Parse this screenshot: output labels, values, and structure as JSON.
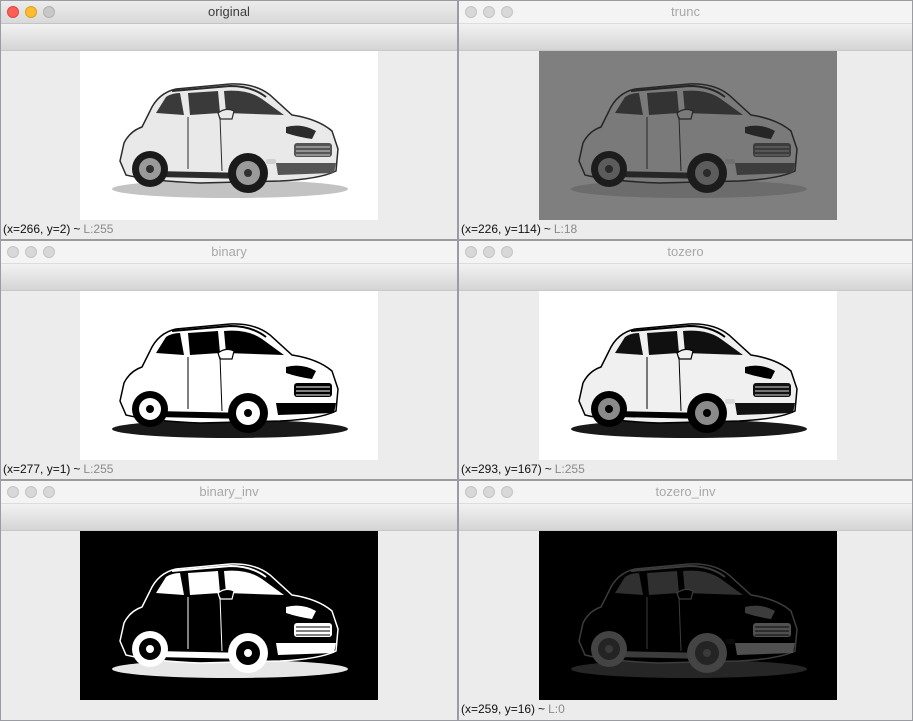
{
  "windows": [
    {
      "title": "original",
      "state": "active",
      "variant": "original",
      "coords": "(x=266, y=2)",
      "sep": "~",
      "lum": "L:255"
    },
    {
      "title": "trunc",
      "state": "inactive",
      "variant": "trunc",
      "coords": "(x=226, y=114)",
      "sep": "~",
      "lum": "L:18"
    },
    {
      "title": "binary",
      "state": "inactive",
      "variant": "binary",
      "coords": "(x=277, y=1)",
      "sep": "~",
      "lum": "L:255"
    },
    {
      "title": "tozero",
      "state": "inactive",
      "variant": "tozero",
      "coords": "(x=293, y=167)",
      "sep": "~",
      "lum": "L:255"
    },
    {
      "title": "binary_inv",
      "state": "inactive",
      "variant": "binary_inv",
      "coords": "",
      "sep": "",
      "lum": ""
    },
    {
      "title": "tozero_inv",
      "state": "inactive",
      "variant": "tozero_inv",
      "coords": "(x=259, y=16)",
      "sep": "~",
      "lum": "L:0"
    }
  ],
  "icons": {
    "close": "close-button-icon",
    "minimize": "minimize-button-icon",
    "zoom": "zoom-button-icon",
    "image": "suv-car-image"
  },
  "colors": {
    "close_red": "#fd5f57",
    "minimize_yellow": "#febc2e",
    "trunc_gray": "#7f7f7f",
    "black": "#000000",
    "white": "#ffffff"
  }
}
